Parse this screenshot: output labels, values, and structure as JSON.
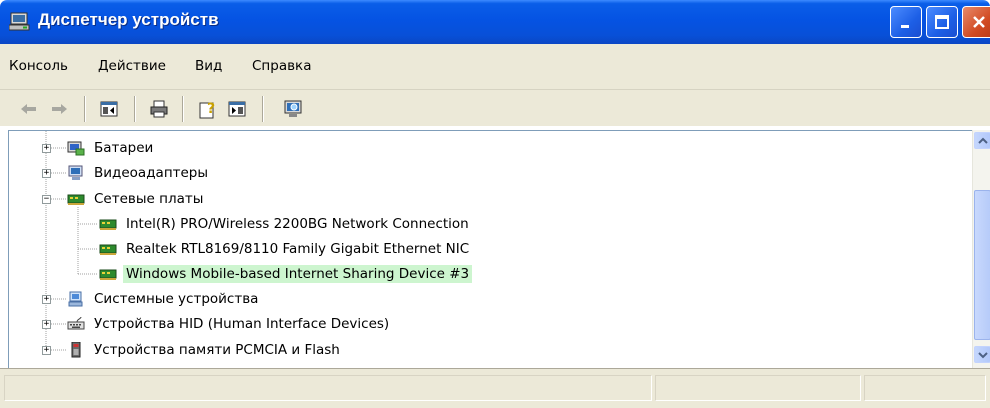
{
  "window": {
    "title": "Диспетчер устройств",
    "icon": "device-manager-icon"
  },
  "title_buttons": [
    "minimize-icon",
    "maximize-icon",
    "close-icon"
  ],
  "menu": {
    "items": [
      {
        "label": "Консоль"
      },
      {
        "label": "Действие"
      },
      {
        "label": "Вид"
      },
      {
        "label": "Справка"
      }
    ]
  },
  "toolbar": {
    "buttons": [
      "back-arrow-icon",
      "forward-arrow-icon",
      "show-hide-console-tree-icon",
      "print-icon",
      "help-icon",
      "properties-pane-icon",
      "scan-hardware-icon"
    ]
  },
  "tree": {
    "items": [
      {
        "label": "Батареи",
        "icon": "battery-icon",
        "expander": "+",
        "level": 1
      },
      {
        "label": "Видеоадаптеры",
        "icon": "display-adapter-icon",
        "expander": "+",
        "level": 1
      },
      {
        "label": "Сетевые платы",
        "icon": "network-card-icon",
        "expander": "-",
        "level": 1
      },
      {
        "label": "Intel(R) PRO/Wireless 2200BG Network Connection",
        "icon": "network-card-icon",
        "level": 2
      },
      {
        "label": "Realtek RTL8169/8110 Family Gigabit Ethernet NIC",
        "icon": "network-card-icon",
        "level": 2
      },
      {
        "label": "Windows Mobile-based Internet Sharing Device #3",
        "icon": "network-card-icon",
        "level": 2,
        "selected": true
      },
      {
        "label": "Системные устройства",
        "icon": "system-device-icon",
        "expander": "+",
        "level": 1
      },
      {
        "label": "Устройства HID (Human Interface Devices)",
        "icon": "hid-device-icon",
        "expander": "+",
        "level": 1
      },
      {
        "label": "Устройства памяти PCMCIA и Flash",
        "icon": "flash-memory-icon",
        "expander": "+",
        "level": 1
      }
    ]
  },
  "colors": {
    "titlebar": "#0553e3",
    "selection": "#cdf5cf",
    "chrome": "#ece9d8"
  }
}
